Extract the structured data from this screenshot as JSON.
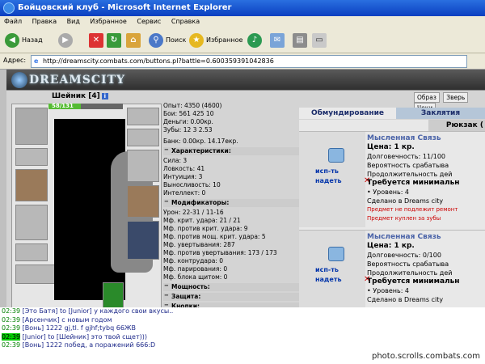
{
  "window": {
    "title": "Бойцовский клуб - Microsoft Internet Explorer"
  },
  "menu": [
    "Файл",
    "Правка",
    "Вид",
    "Избранное",
    "Сервис",
    "Справка"
  ],
  "toolbar": {
    "back": "Назад",
    "search": "Поиск",
    "favorites": "Избранное"
  },
  "address": {
    "label": "Адрес:",
    "url": "http://dreamscity.combats.com/buttons.pl?battle=0.600359391042836"
  },
  "logo": "DREAMSCITY",
  "character": {
    "name": "Шейник [4]",
    "hp_text": "58/131",
    "hp_fraction": 0.44
  },
  "stats": {
    "exp": "Опыт: 4350 (4600)",
    "battles": "Бои: 561 425 10",
    "money": "Деньги: 0.00кр.",
    "teeth": "Зубы: 12 3 2.53",
    "bank": "Банк: 0.00кр. 14.17екр."
  },
  "characteristics": {
    "header": "Характеристики:",
    "rows": [
      "Сила: 3",
      "Ловкость: 41",
      "Интуиция: 3",
      "Выносливость: 10",
      "Интеллект: 0"
    ]
  },
  "modifiers": {
    "header": "Модификаторы:",
    "rows": [
      "Урон: 22-31 / 11-16",
      "Мф. крит. удара: 21 / 21",
      "Мф. против крит. удара: 9",
      "Мф. против мощ. крит. удара: 5",
      "Мф. увертывания: 287",
      "Мф. против увертывания: 173 / 173",
      "Мф. контрудара: 0",
      "Мф. парирования: 0",
      "Мф. блока щитом: 0"
    ]
  },
  "sections": [
    "Мощность:",
    "Защита:",
    "Кнопки:"
  ],
  "top_buttons": [
    "Образ",
    "Зверь",
    "Чеки"
  ],
  "tabs": {
    "equipment": "Обмундирование",
    "curse": "Заклятия",
    "bag": "Рюкзак ("
  },
  "items": [
    {
      "act1": "исп-ть",
      "act2": "надеть",
      "name": "Мысленная Связь",
      "price": "Цена: 1 кр.",
      "durability": "Долговечность: 11/100",
      "prob": "Вероятность срабатыва",
      "duration": "Продолжительность дей",
      "req": "Требуется минимальн",
      "level": "• Уровень: 4",
      "made": "Сделано в Dreams city",
      "red1": "Предмет не подлежит ремонт",
      "red2": "Предмет куплен за зубы"
    },
    {
      "act1": "исп-ть",
      "act2": "надеть",
      "name": "Мысленная Связь",
      "price": "Цена: 1 кр.",
      "durability": "Долговечность: 0/100",
      "prob": "Вероятность срабатыва",
      "duration": "Продолжительность дей",
      "req": "Требуется минимальн",
      "level": "• Уровень: 4",
      "made": "Сделано в Dreams city"
    }
  ],
  "chat": [
    {
      "time": "02:39",
      "user": "[Это Батя]",
      "msg": "to [Junior] у каждого свои вкусы..",
      "hl": false
    },
    {
      "time": "02:39",
      "user": "[Арсенчик]",
      "msg": "с новым годом",
      "hl": false
    },
    {
      "time": "02:39",
      "user": "[Вонь]",
      "msg": "1222 gj,tl. f gjhf;tybq 66ЖВ",
      "hl": false
    },
    {
      "time": "02:39",
      "user": "[Junior]",
      "msg": "to [Шейник] это твой сщет)))",
      "hl": true
    },
    {
      "time": "02:39",
      "user": "[Вонь]",
      "msg": "1222 побед, а поражений 666:D",
      "hl": false
    }
  ],
  "watermark": "photo.scrolls.combats.com"
}
